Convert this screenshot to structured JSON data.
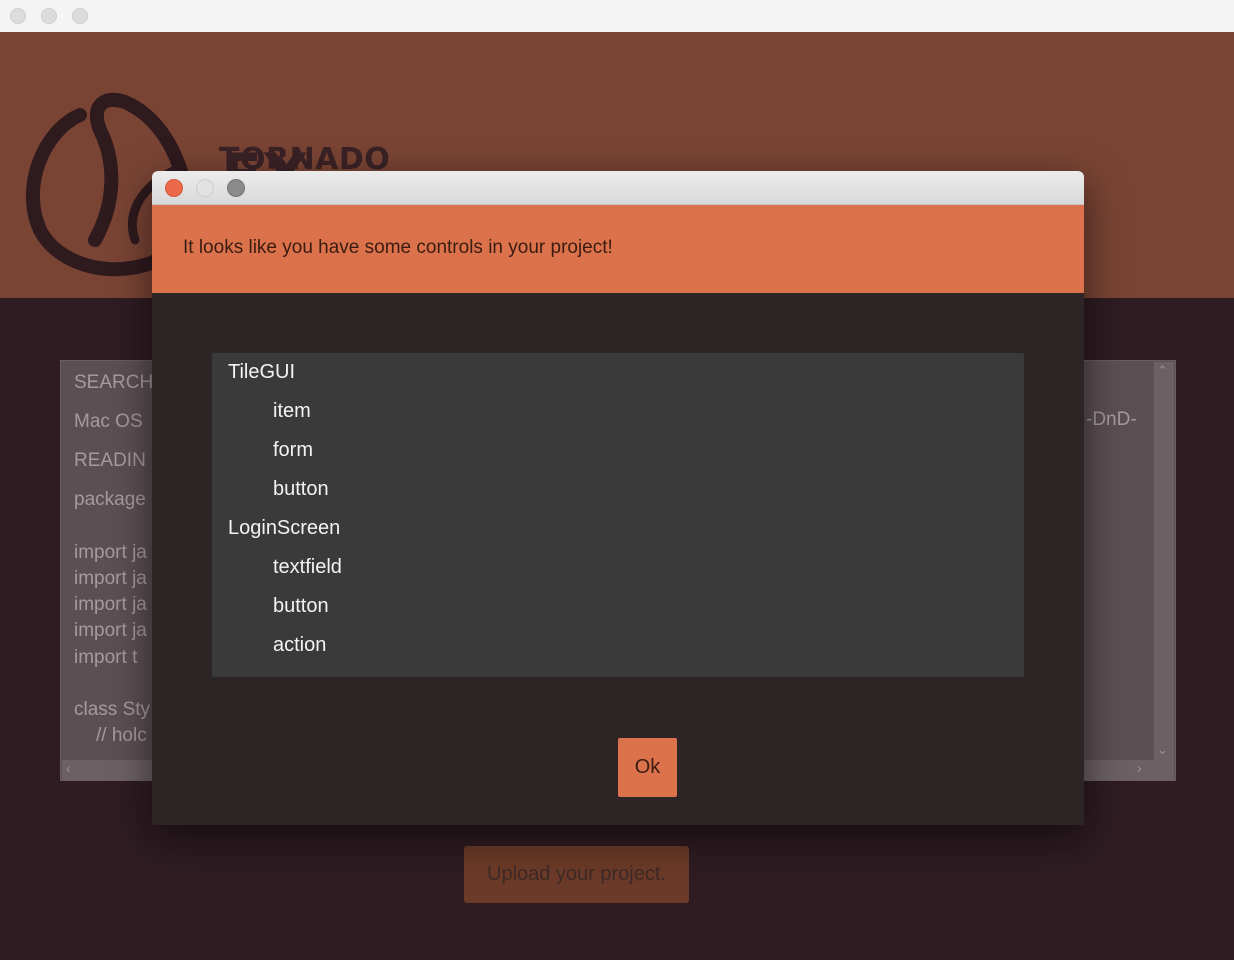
{
  "window": {
    "traffic_lights": [
      "close",
      "minimize",
      "zoom"
    ]
  },
  "banner": {
    "brand_name": "TORNADO",
    "brand_suffix": "FX",
    "background_color": "#7a4434"
  },
  "background": {
    "left_lines": [
      "SEARCH",
      "Mac OS",
      "READIN",
      "package",
      "import ja",
      "import ja",
      "import ja",
      "import ja",
      "import t",
      "class Sty",
      "// holc"
    ],
    "right_fragment": "-DnD-",
    "upload_button_label": "Upload your project."
  },
  "dialog": {
    "message": "It looks like you have some controls in your project!",
    "header_color": "#dc724b",
    "tree": [
      {
        "label": "TileGUI",
        "children": [
          "item",
          "form",
          "button"
        ]
      },
      {
        "label": "LoginScreen",
        "children": [
          "textfield",
          "button",
          "action"
        ]
      }
    ],
    "ok_label": "Ok"
  }
}
